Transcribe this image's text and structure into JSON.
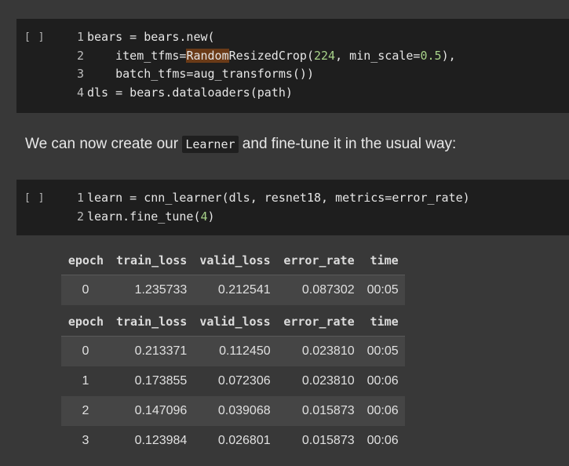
{
  "cells": [
    {
      "run_label": "[ ]",
      "lines": [
        {
          "n": "1",
          "parts": [
            {
              "t": "bears = bears.new("
            }
          ]
        },
        {
          "n": "2",
          "parts": [
            {
              "t": "    item_tfms="
            },
            {
              "t": "Random",
              "hl": true
            },
            {
              "t": "ResizedCrop("
            },
            {
              "t": "224",
              "num": true
            },
            {
              "t": ", min_scale="
            },
            {
              "t": "0.5",
              "num": true
            },
            {
              "t": "),"
            }
          ]
        },
        {
          "n": "3",
          "parts": [
            {
              "t": "    batch_tfms=aug_transforms())"
            }
          ]
        },
        {
          "n": "4",
          "parts": [
            {
              "t": "dls = bears.dataloaders(path)"
            }
          ]
        }
      ]
    },
    {
      "run_label": "[ ]",
      "lines": [
        {
          "n": "1",
          "parts": [
            {
              "t": "learn = cnn_learner(dls, resnet18, metrics=error_rate)"
            }
          ]
        },
        {
          "n": "2",
          "parts": [
            {
              "t": "learn.fine_tune("
            },
            {
              "t": "4",
              "num": true
            },
            {
              "t": ")"
            }
          ]
        }
      ]
    }
  ],
  "markdown": {
    "before": "We can now create our ",
    "code": "Learner",
    "after": " and fine-tune it in the usual way:"
  },
  "tables": [
    {
      "headers": [
        "epoch",
        "train_loss",
        "valid_loss",
        "error_rate",
        "time"
      ],
      "rows": [
        [
          "0",
          "1.235733",
          "0.212541",
          "0.087302",
          "00:05"
        ]
      ]
    },
    {
      "headers": [
        "epoch",
        "train_loss",
        "valid_loss",
        "error_rate",
        "time"
      ],
      "rows": [
        [
          "0",
          "0.213371",
          "0.112450",
          "0.023810",
          "00:05"
        ],
        [
          "1",
          "0.173855",
          "0.072306",
          "0.023810",
          "00:06"
        ],
        [
          "2",
          "0.147096",
          "0.039068",
          "0.015873",
          "00:06"
        ],
        [
          "3",
          "0.123984",
          "0.026801",
          "0.015873",
          "00:06"
        ]
      ]
    }
  ]
}
